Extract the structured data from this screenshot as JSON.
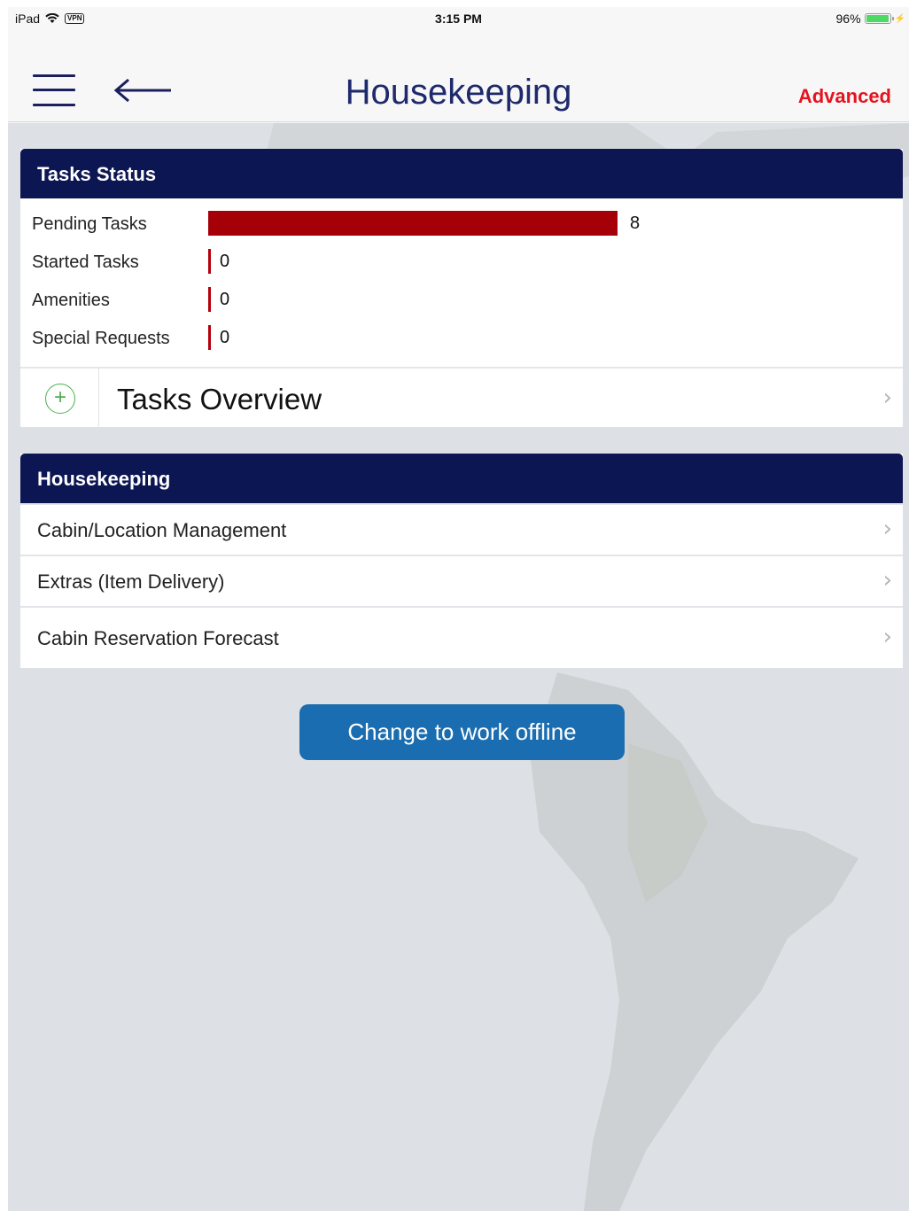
{
  "status_bar": {
    "device": "iPad",
    "vpn": "VPN",
    "time": "3:15 PM",
    "battery_percent": "96%",
    "battery_level": 0.96
  },
  "nav": {
    "title": "Housekeeping",
    "advanced_label": "Advanced",
    "icons": [
      "menu-icon",
      "back-arrow-icon"
    ]
  },
  "tasks_status": {
    "header": "Tasks Status",
    "rows": [
      {
        "label": "Pending Tasks",
        "value": 8
      },
      {
        "label": "Started Tasks",
        "value": 0
      },
      {
        "label": "Amenities",
        "value": 0
      },
      {
        "label": "Special Requests",
        "value": 0
      }
    ],
    "overview_label": "Tasks Overview",
    "overview_icon": "plus-circle-icon"
  },
  "housekeeping": {
    "header": "Housekeeping",
    "items": [
      {
        "label": "Cabin/Location Management"
      },
      {
        "label": "Extras (Item Delivery)"
      },
      {
        "label": "Cabin Reservation Forecast"
      }
    ]
  },
  "offline_button": "Change to work offline",
  "colors": {
    "header_bg": "#0c1652",
    "bar": "#a50008",
    "accent_red": "#e3141f",
    "button": "#1a6db0",
    "title": "#1f2a6d"
  }
}
